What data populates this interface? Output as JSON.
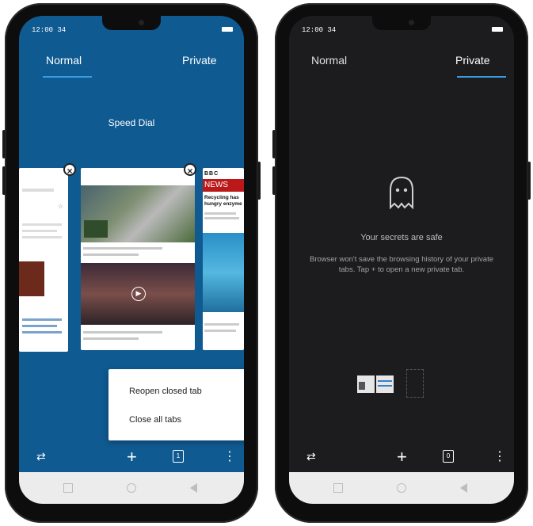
{
  "left_phone": {
    "status_time": "12:00 34",
    "tabs": [
      "Normal",
      "Private"
    ],
    "active_tab": "Normal",
    "speed_dial": "Speed Dial",
    "news_card": {
      "brand": "BBC",
      "section": "NEWS",
      "headline": "Recycling has hungry enzyme"
    },
    "popup_menu": [
      "Reopen closed tab",
      "Close all tabs"
    ],
    "bottom_icons": [
      "swap-icon",
      "add-icon",
      "tabs-icon",
      "more-icon"
    ]
  },
  "right_phone": {
    "status_time": "12:00 34",
    "tabs": [
      "Normal",
      "Private"
    ],
    "active_tab": "Private",
    "secrets_title": "Your secrets are safe",
    "secrets_body": "Browser won't save the browsing history of your private tabs. Tap + to open a new private tab.",
    "bottom_icons": [
      "swap-icon",
      "add-icon",
      "tabs-icon",
      "more-icon"
    ]
  },
  "colors": {
    "normal_bg": "#0f5a91",
    "private_bg": "#1c1c1e",
    "accent": "#3b9be0"
  }
}
